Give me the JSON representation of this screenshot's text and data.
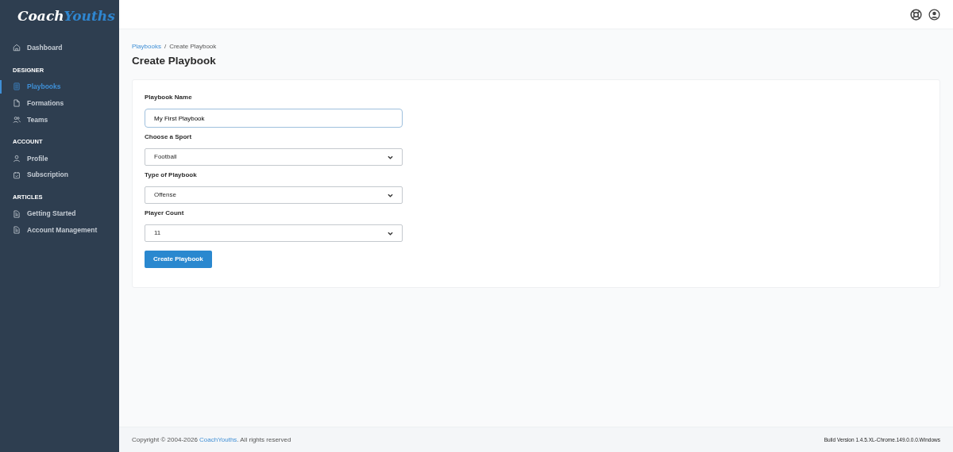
{
  "logo": {
    "first": "Coach",
    "second": "Youths"
  },
  "sidebar": {
    "sections": [
      {
        "items": [
          {
            "label": "Dashboard",
            "kind": "home",
            "selected": false
          }
        ]
      },
      {
        "heading": "DESIGNER",
        "items": [
          {
            "label": "Playbooks",
            "kind": "book",
            "selected": true
          },
          {
            "label": "Formations",
            "kind": "file",
            "selected": false
          },
          {
            "label": "Teams",
            "kind": "users",
            "selected": false
          }
        ]
      },
      {
        "heading": "ACCOUNT",
        "items": [
          {
            "label": "Profile",
            "kind": "user",
            "selected": false
          },
          {
            "label": "Subscription",
            "kind": "box",
            "selected": false
          }
        ]
      },
      {
        "heading": "ARTICLES",
        "items": [
          {
            "label": "Getting Started",
            "kind": "doc",
            "selected": false
          },
          {
            "label": "Account Management",
            "kind": "doc",
            "selected": false
          }
        ]
      }
    ]
  },
  "breadcrumb": {
    "separator": "/",
    "items": [
      {
        "label": "Playbooks",
        "link": true
      },
      {
        "label": "Create Playbook",
        "link": false
      }
    ]
  },
  "page_title": "Create Playbook",
  "form": {
    "fields": [
      {
        "kind": "text",
        "label": "Playbook Name",
        "value": "My First Playbook"
      },
      {
        "kind": "select",
        "label": "Choose a Sport",
        "value": "Football"
      },
      {
        "kind": "select",
        "label": "Type of Playbook",
        "value": "Offense"
      },
      {
        "kind": "select",
        "label": "Player Count",
        "value": "11"
      }
    ],
    "submit": "Create Playbook"
  },
  "footer": {
    "copyright_before": "Copyright © 2004-2026 ",
    "copyright_link": "CoachYouths",
    "copyright_after": ". All rights reserved",
    "build": "Build Version 1.4.5.XL-Chrome.149.0.0.0.Windows"
  }
}
